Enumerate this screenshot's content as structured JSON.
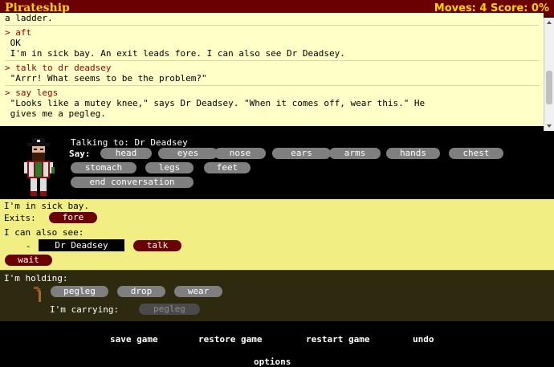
{
  "header": {
    "title": "Pirateship",
    "status": "Moves: 4 Score: 0%"
  },
  "transcript": [
    {
      "text": "a ladder.",
      "cmd": false
    },
    {
      "sep": true
    },
    {
      "text": "> aft",
      "cmd": true
    },
    {
      "text": " OK",
      "cmd": false
    },
    {
      "text": " I'm in sick bay. An exit leads fore. I can also see Dr Deadsey.",
      "cmd": false
    },
    {
      "sep": true
    },
    {
      "text": "> talk to dr deadsey",
      "cmd": true
    },
    {
      "text": " \"Arrr! What seems to be the problem?\"",
      "cmd": false
    },
    {
      "sep": true
    },
    {
      "text": "> say legs",
      "cmd": true
    },
    {
      "text": " \"Looks like a mutey knee,\" says Dr Deadsey. \"When it comes off, wear this.\" He",
      "cmd": false
    },
    {
      "text": " gives me a pegleg.",
      "cmd": false
    }
  ],
  "conversation": {
    "talking_to": "Talking to: Dr Deadsey",
    "say_label": "Say:",
    "options": [
      "head",
      "eyes",
      "nose",
      "ears",
      "arms",
      "hands",
      "chest",
      "stomach",
      "legs",
      "feet"
    ],
    "end_label": "end conversation"
  },
  "location": {
    "description": "I'm in sick bay.",
    "exits_label": "Exits:",
    "exit_fore": "fore",
    "also_see": "I can also see:",
    "dash": "-",
    "character": "Dr Deadsey",
    "talk_label": "talk",
    "wait_label": "wait"
  },
  "inventory": {
    "holding_label": "I'm holding:",
    "item": "pegleg",
    "drop_label": "drop",
    "wear_label": "wear",
    "carrying_label": "I'm carrying:",
    "carrying_item": "pegleg"
  },
  "footer": {
    "save": "save game",
    "restore": "restore game",
    "restart": "restart game",
    "undo": "undo",
    "options": "options"
  },
  "icons": {
    "portrait": "pirate-doctor-icon",
    "item": "pegleg-icon"
  }
}
